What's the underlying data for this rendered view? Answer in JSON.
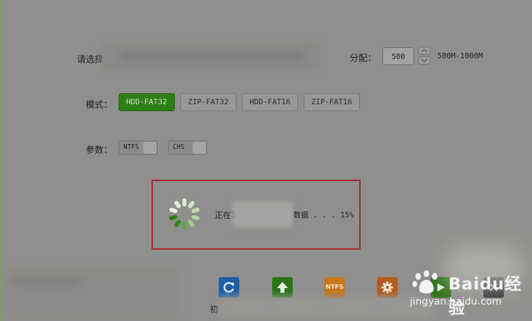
{
  "disk": {
    "label": "请选择"
  },
  "alloc": {
    "label": "分配：",
    "value": "500",
    "range": "500M-1000M"
  },
  "mode": {
    "label": "模式：",
    "options": [
      "HDD-FAT32",
      "ZIP-FAT32",
      "HDD-FAT16",
      "ZIP-FAT16"
    ],
    "selected": "HDD-FAT32"
  },
  "params": {
    "label": "参数：",
    "toggles": [
      {
        "label": "NTFS",
        "on": false
      },
      {
        "label": "CHS",
        "on": false
      }
    ]
  },
  "progress": {
    "prefix": "正在写",
    "suffix": "数据 . . . 15%",
    "percent": 15
  },
  "toolbar": {
    "first_label": "初",
    "ntfs_text": "NTFS"
  },
  "watermark": {
    "brand": "Baidu经验",
    "url": "jingyan.baidu.com"
  },
  "colors": {
    "accent": "#2e7d16",
    "highlight_border": "#a8252a"
  }
}
